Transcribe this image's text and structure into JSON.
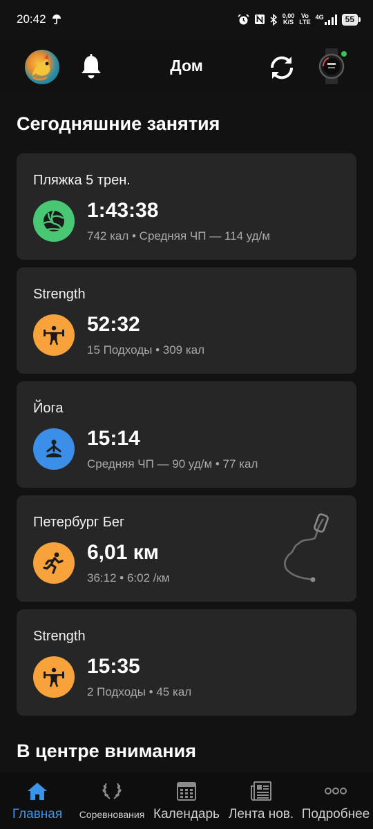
{
  "status_bar": {
    "time": "20:42",
    "net_speed_value": "0,00",
    "net_speed_unit": "K/S",
    "volte_top": "Vo",
    "volte_bottom": "LTE",
    "network": "4G",
    "battery": "55"
  },
  "header": {
    "title": "Дом"
  },
  "sections": {
    "today_title": "Сегодняшние занятия",
    "spotlight_title": "В центре внимания"
  },
  "activities": [
    {
      "title": "Пляжка 5 трен.",
      "main": "1:43:38",
      "sub": "742 кал • Средняя ЧП — 114 уд/м",
      "icon": "volleyball-icon",
      "color": "#48c774"
    },
    {
      "title": "Strength",
      "main": "52:32",
      "sub": "15 Подходы • 309 кал",
      "icon": "weightlifting-icon",
      "color": "#f7a23b"
    },
    {
      "title": "Йога",
      "main": "15:14",
      "sub": "Средняя ЧП — 90 уд/м • 77 кал",
      "icon": "yoga-icon",
      "color": "#3b8fe8"
    },
    {
      "title": "Петербург Бег",
      "main": "6,01 км",
      "sub": "36:12 • 6:02 /км",
      "icon": "running-icon",
      "color": "#f7a23b"
    },
    {
      "title": "Strength",
      "main": "15:35",
      "sub": "2 Подходы • 45 кал",
      "icon": "weightlifting-icon",
      "color": "#f7a23b"
    }
  ],
  "nav": [
    {
      "label": "Главная",
      "icon": "home-icon",
      "active": true
    },
    {
      "label": "Соревнования",
      "icon": "laurel-icon",
      "active": false
    },
    {
      "label": "Календарь",
      "icon": "calendar-icon",
      "active": false
    },
    {
      "label": "Лента нов.",
      "icon": "newsfeed-icon",
      "active": false
    },
    {
      "label": "Подробнее",
      "icon": "more-icon",
      "active": false
    }
  ]
}
